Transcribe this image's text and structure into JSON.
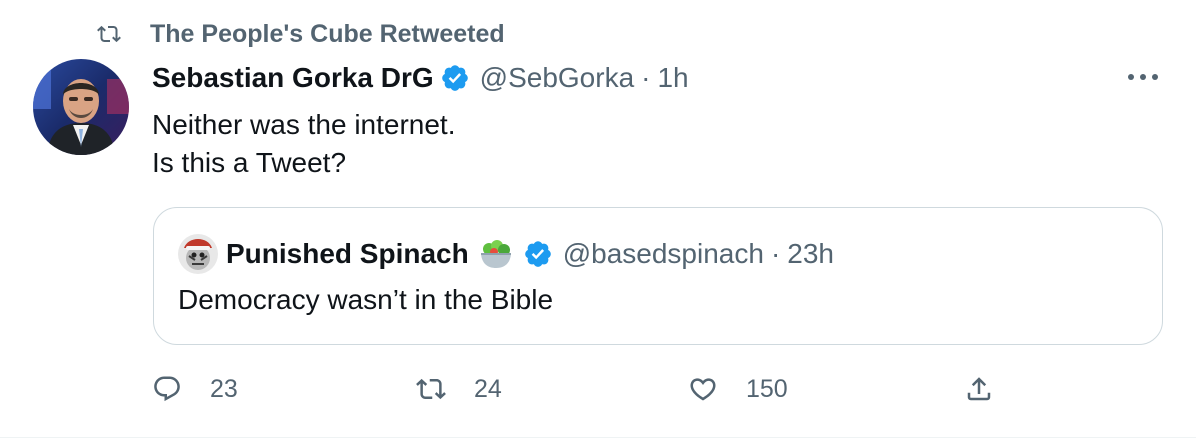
{
  "retweet": {
    "text": "The People's Cube Retweeted",
    "icon": "retweet-icon"
  },
  "tweet": {
    "author": {
      "display_name": "Sebastian Gorka DrG",
      "handle": "@SebGorka",
      "verified": true
    },
    "separator": "·",
    "time": "1h",
    "lines": [
      "Neither was the internet.",
      "Is this a Tweet?"
    ]
  },
  "quote": {
    "author": {
      "display_name": "Punished Spinach",
      "handle": "@basedspinach",
      "verified": true,
      "emoji": "salad-bowl-icon"
    },
    "separator": "·",
    "time": "23h",
    "text": "Democracy wasn’t in the Bible"
  },
  "actions": {
    "replies": "23",
    "retweets": "24",
    "likes": "150"
  },
  "colors": {
    "text": "#0f1419",
    "secondary": "#536471",
    "verified_blue": "#1d9bf0",
    "border": "#cfd9de"
  }
}
